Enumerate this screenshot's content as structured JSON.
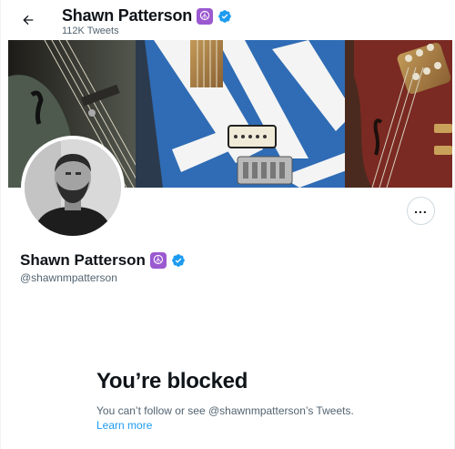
{
  "header": {
    "name": "Shawn Patterson",
    "tweet_count": "112K Tweets",
    "back_icon": "arrow-left-icon"
  },
  "profile": {
    "name": "Shawn Patterson",
    "handle": "@shawnmpatterson",
    "badge_emoji": "☮",
    "badge_color": "#9b59d0",
    "verified_color": "#1d9bf0"
  },
  "actions": {
    "more_icon": "more-horizontal-icon"
  },
  "blocked": {
    "title": "You’re blocked",
    "description": "You can’t follow or see @shawnmpatterson’s Tweets.",
    "learn_more": "Learn more"
  },
  "colors": {
    "text_primary": "#0f1419",
    "text_secondary": "#536471",
    "link": "#1d9bf0"
  }
}
